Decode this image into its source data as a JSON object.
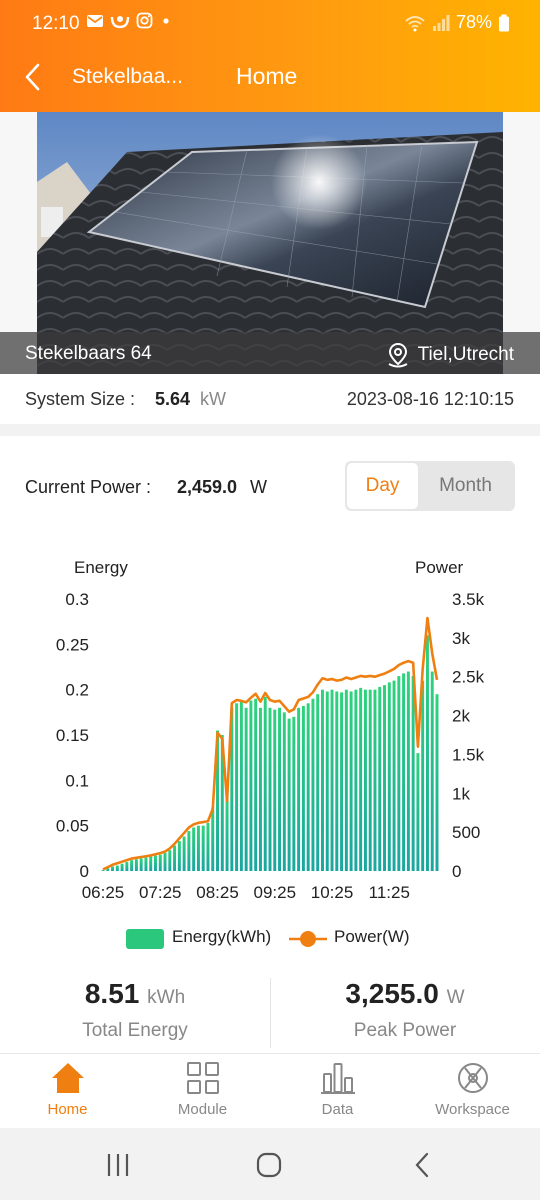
{
  "status_bar": {
    "time": "12:10",
    "battery": "78%",
    "icons_left": [
      "mail-icon",
      "weibo-icon",
      "instagram-icon",
      "dot-icon"
    ],
    "icons_right": [
      "wifi-icon",
      "signal-icon",
      "battery-icon"
    ]
  },
  "header": {
    "plant_name": "Stekelbaa...",
    "title": "Home"
  },
  "photo": {
    "name": "Stekelbaars 64",
    "location": "Tiel,Utrecht"
  },
  "system": {
    "size_label": "System Size :",
    "size_value": "5.64",
    "size_unit": "kW",
    "timestamp": "2023-08-16 12:10:15"
  },
  "power": {
    "label": "Current Power :",
    "value": "2,459.0",
    "unit": "W"
  },
  "toggle": {
    "day": "Day",
    "month": "Month",
    "selected": "Day"
  },
  "chart_data": {
    "type": "bar+line",
    "left_axis_label": "Energy",
    "right_axis_label": "Power",
    "left_ticks": [
      "0.3",
      "0.25",
      "0.2",
      "0.15",
      "0.1",
      "0.05",
      "0"
    ],
    "right_ticks": [
      "3.5k",
      "3k",
      "2.5k",
      "2k",
      "1.5k",
      "1k",
      "500",
      "0"
    ],
    "x_ticks": [
      "06:25",
      "07:25",
      "08:25",
      "09:25",
      "10:25",
      "11:25"
    ],
    "ylim_left": [
      0,
      0.3
    ],
    "ylim_right": [
      0,
      3500
    ],
    "x_start": "06:25",
    "interval_minutes": 5,
    "series": [
      {
        "name": "Energy(kWh)",
        "color": "#2ac77d",
        "values": [
          0.001,
          0.003,
          0.005,
          0.006,
          0.008,
          0.01,
          0.012,
          0.013,
          0.014,
          0.015,
          0.016,
          0.017,
          0.018,
          0.02,
          0.023,
          0.028,
          0.033,
          0.038,
          0.044,
          0.048,
          0.05,
          0.05,
          0.053,
          0.07,
          0.155,
          0.15,
          0.08,
          0.18,
          0.185,
          0.188,
          0.18,
          0.188,
          0.19,
          0.18,
          0.192,
          0.18,
          0.178,
          0.18,
          0.175,
          0.168,
          0.17,
          0.18,
          0.182,
          0.185,
          0.19,
          0.195,
          0.2,
          0.198,
          0.2,
          0.198,
          0.197,
          0.2,
          0.198,
          0.2,
          0.202,
          0.2,
          0.2,
          0.2,
          0.203,
          0.205,
          0.208,
          0.21,
          0.215,
          0.218,
          0.22,
          0.215,
          0.13,
          0.21,
          0.26,
          0.22,
          0.195
        ]
      },
      {
        "name": "Power(W)",
        "color": "#f07f11",
        "values": [
          20,
          50,
          80,
          100,
          120,
          140,
          160,
          170,
          180,
          190,
          200,
          215,
          230,
          250,
          290,
          350,
          420,
          490,
          560,
          600,
          620,
          630,
          640,
          800,
          1780,
          1700,
          900,
          2160,
          2200,
          2190,
          2170,
          2230,
          2280,
          2180,
          2290,
          2200,
          2180,
          2190,
          2120,
          2050,
          2080,
          2200,
          2220,
          2240,
          2300,
          2400,
          2480,
          2460,
          2470,
          2450,
          2460,
          2490,
          2470,
          2490,
          2510,
          2500,
          2510,
          2500,
          2520,
          2540,
          2570,
          2600,
          2650,
          2680,
          2700,
          2680,
          1600,
          2600,
          3255,
          2800,
          2459
        ]
      }
    ]
  },
  "legend": {
    "energy": "Energy(kWh)",
    "power": "Power(W)"
  },
  "stats": {
    "total_energy_value": "8.51",
    "total_energy_unit": "kWh",
    "total_energy_label": "Total Energy",
    "peak_power_value": "3,255.0",
    "peak_power_unit": "W",
    "peak_power_label": "Peak Power"
  },
  "bottom_nav": {
    "items": [
      {
        "label": "Home",
        "icon": "house-icon",
        "active": true
      },
      {
        "label": "Module",
        "icon": "grid-icon",
        "active": false
      },
      {
        "label": "Data",
        "icon": "bar-chart-icon",
        "active": false
      },
      {
        "label": "Workspace",
        "icon": "workspace-icon",
        "active": false
      }
    ]
  },
  "colors": {
    "accent": "#f07f11",
    "header_start": "#ff7a14",
    "header_end": "#ffb300",
    "energy_bar": "#2ac77d"
  }
}
